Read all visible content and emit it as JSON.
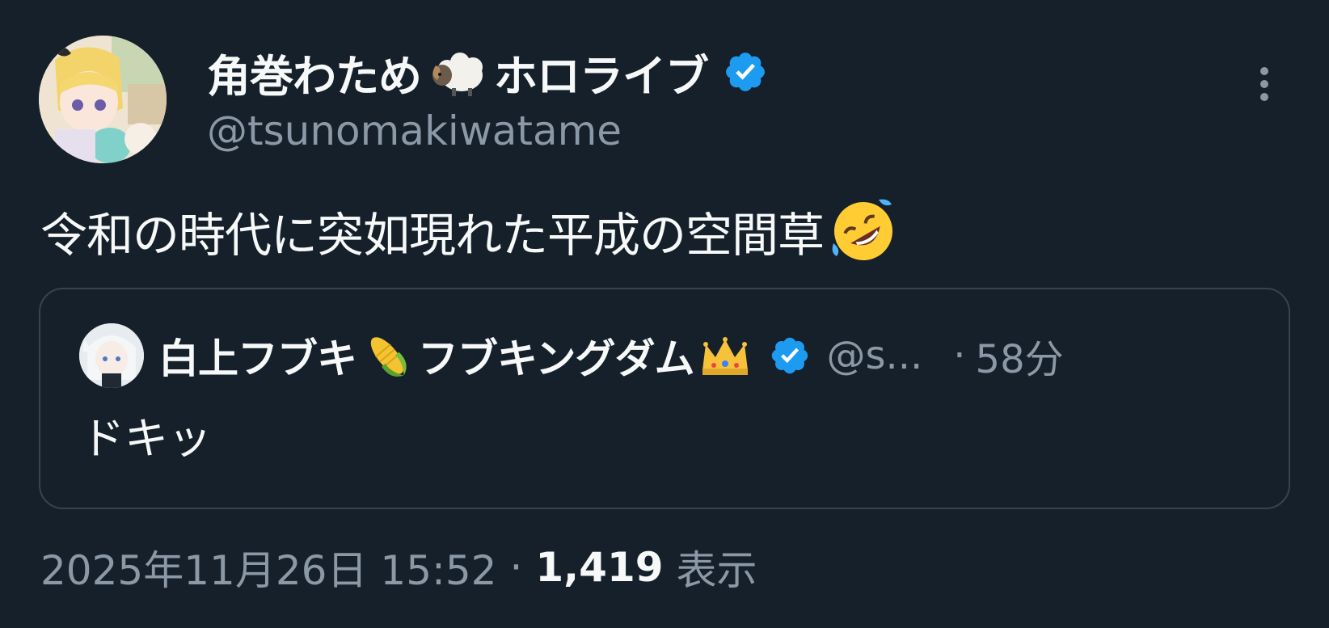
{
  "author": {
    "display_name": "角巻わため",
    "display_name_suffix": "ホロライブ",
    "handle": "@tsunomakiwatame",
    "verified": true,
    "emoji": "sheep-emoji",
    "avatar": "avatar-image"
  },
  "tweet": {
    "text": "令和の時代に突如現れた平成の空間草",
    "trailing_emoji": "rolling-on-floor-laughing-emoji"
  },
  "quoted_tweet": {
    "display_name_part1": "白上フブキ",
    "display_name_part2": "フブキングダム",
    "emoji_1": "corn-emoji",
    "emoji_2": "crown-emoji",
    "verified": true,
    "handle": "@s...",
    "separator": "·",
    "time": "58分",
    "text": "ドキッ"
  },
  "meta": {
    "timestamp": "2025年11月26日 15:52",
    "separator": "·",
    "view_count": "1,419",
    "view_label": "表示"
  },
  "colors": {
    "background": "#15202b",
    "primary_text": "#f7f9f9",
    "secondary_text": "#8b98a5",
    "border": "#38444d",
    "verified_blue": "#1d9bf0"
  },
  "icons": {
    "more": "more-vertical-icon",
    "verified": "verified-badge-icon"
  }
}
